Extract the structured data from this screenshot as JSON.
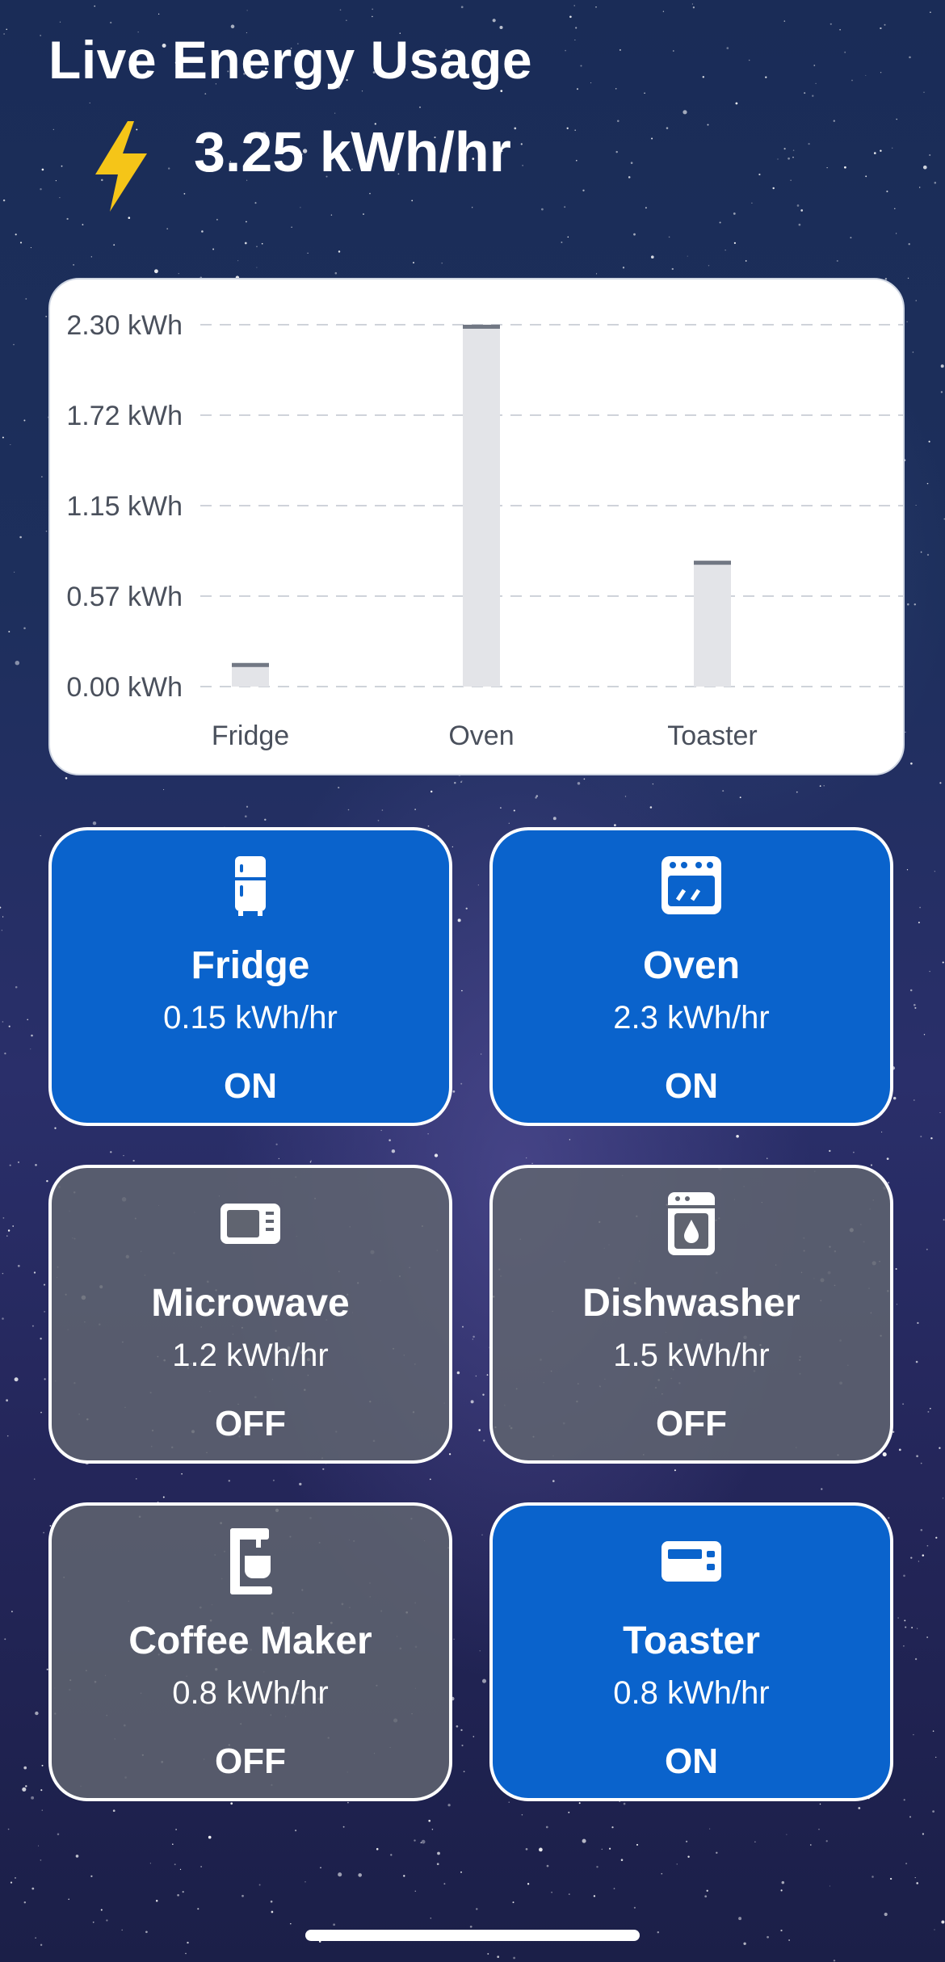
{
  "header": {
    "title": "Live Energy Usage",
    "live_value": "3.25 kWh/hr",
    "bolt_icon": "lightning-bolt-icon",
    "bolt_color": "#f5c518"
  },
  "chart_data": {
    "type": "bar",
    "categories": [
      "Fridge",
      "Oven",
      "Toaster"
    ],
    "values": [
      0.15,
      2.3,
      0.8
    ],
    "unit": "kWh",
    "yticks": [
      "2.30 kWh",
      "1.72 kWh",
      "1.15 kWh",
      "0.57 kWh",
      "0.00 kWh"
    ],
    "ylim": [
      0,
      2.3
    ],
    "grid": true,
    "colors": {
      "bar": "#e3e4e8",
      "cap": "#727884",
      "grid": "#cfd3da",
      "text": "#4a505c"
    }
  },
  "appliances": [
    {
      "name": "Fridge",
      "rate": "0.15 kWh/hr",
      "state": "ON",
      "icon": "fridge-icon"
    },
    {
      "name": "Oven",
      "rate": "2.3 kWh/hr",
      "state": "ON",
      "icon": "oven-icon"
    },
    {
      "name": "Microwave",
      "rate": "1.2 kWh/hr",
      "state": "OFF",
      "icon": "microwave-icon"
    },
    {
      "name": "Dishwasher",
      "rate": "1.5 kWh/hr",
      "state": "OFF",
      "icon": "dishwasher-icon"
    },
    {
      "name": "Coffee Maker",
      "rate": "0.8 kWh/hr",
      "state": "OFF",
      "icon": "coffee-maker-icon"
    },
    {
      "name": "Toaster",
      "rate": "0.8 kWh/hr",
      "state": "ON",
      "icon": "toaster-icon"
    }
  ],
  "colors": {
    "on": "#0a63cc",
    "off": "#606470"
  }
}
